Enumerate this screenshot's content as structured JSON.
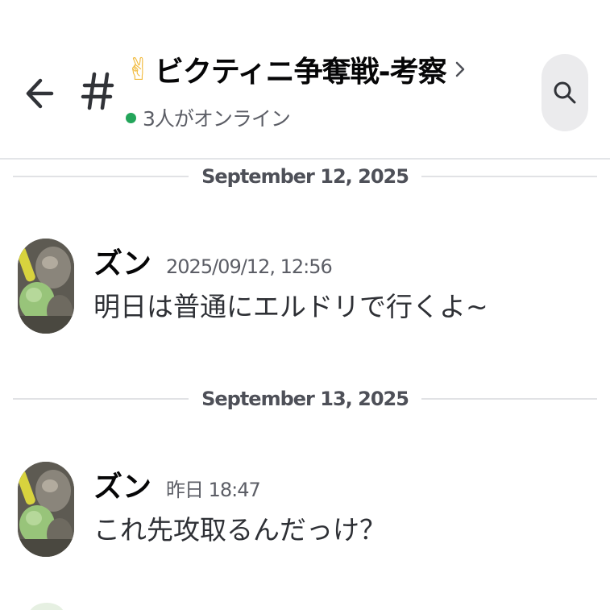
{
  "header": {
    "back_icon": "arrow-left-icon",
    "channel_icon": "hash-icon",
    "title_emoji": "✌",
    "title": "ビクティニ争奪戦-考察",
    "online_text": "3人がオンライン",
    "online_color": "#23a55a",
    "search_icon": "search-icon"
  },
  "messages_area": {
    "groups": [
      {
        "date": "September 12, 2025",
        "message": {
          "author": "ズン",
          "timestamp": "2025/09/12, 12:56",
          "text": "明日は普通にエルドリで行くよ~"
        }
      },
      {
        "date": "September 13, 2025",
        "message": {
          "author": "ズン",
          "timestamp": "昨日 18:47",
          "text": "これ先攻取るんだっけ？"
        }
      }
    ]
  }
}
